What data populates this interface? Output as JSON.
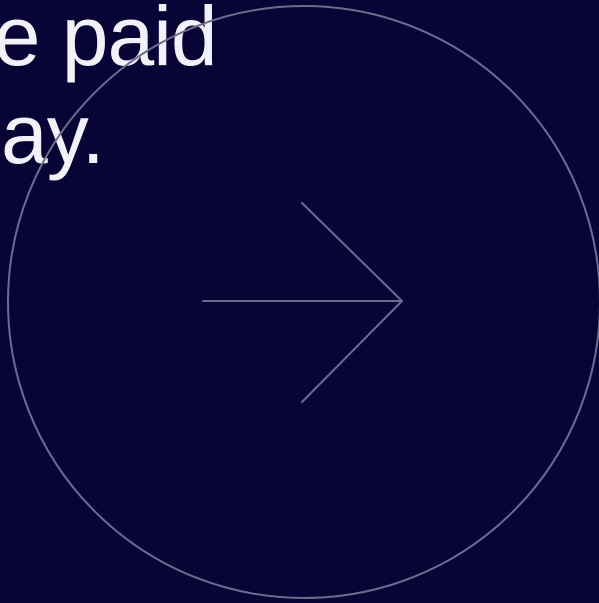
{
  "headline": {
    "line1": "be paid",
    "line2": "ay."
  },
  "cta": {
    "icon": "arrow-right-icon",
    "ring_color": "#6e6b8f",
    "arrow_color": "#6e6b8f"
  },
  "colors": {
    "background": "#080536",
    "text": "#f2f1f7"
  }
}
